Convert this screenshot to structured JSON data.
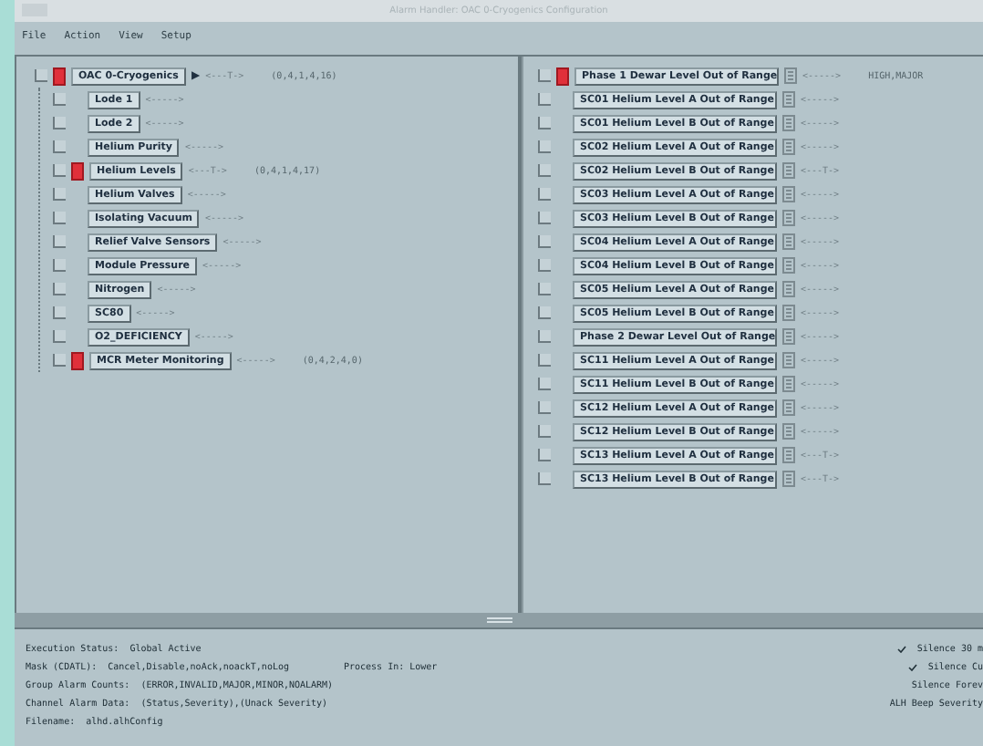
{
  "window": {
    "title": "Alarm Handler: OAC 0-Cryogenics Configuration"
  },
  "menu": [
    "File",
    "Action",
    "View",
    "Setup"
  ],
  "tree": [
    {
      "label": "OAC 0-Cryogenics",
      "alarm": true,
      "arrow": "▶",
      "mask": "<---T->",
      "counts": "(0,4,1,4,16)",
      "children": [
        {
          "label": "Lode 1",
          "alarm": false,
          "mask": "<----->"
        },
        {
          "label": "Lode 2",
          "alarm": false,
          "mask": "<----->"
        },
        {
          "label": "Helium Purity",
          "alarm": false,
          "mask": "<----->"
        },
        {
          "label": "Helium Levels",
          "alarm": true,
          "mask": "<---T->",
          "counts": "(0,4,1,4,17)"
        },
        {
          "label": "Helium Valves",
          "alarm": false,
          "mask": "<----->"
        },
        {
          "label": "Isolating Vacuum",
          "alarm": false,
          "mask": "<----->"
        },
        {
          "label": "Relief Valve Sensors",
          "alarm": false,
          "mask": "<----->"
        },
        {
          "label": "Module Pressure",
          "alarm": false,
          "mask": "<----->"
        },
        {
          "label": "Nitrogen",
          "alarm": false,
          "mask": "<----->"
        },
        {
          "label": "SC80",
          "alarm": false,
          "mask": "<----->"
        },
        {
          "label": "O2_DEFICIENCY",
          "alarm": false,
          "mask": "<----->"
        },
        {
          "label": "MCR Meter Monitoring",
          "alarm": true,
          "mask": "<----->",
          "counts": "(0,4,2,4,0)"
        }
      ]
    }
  ],
  "alarms": [
    {
      "label": "Phase 1 Dewar Level Out of Range",
      "alarm": true,
      "mask": "<----->",
      "status": "HIGH,MAJOR"
    },
    {
      "label": "SC01 Helium Level A Out of Range",
      "alarm": false,
      "mask": "<----->"
    },
    {
      "label": "SC01 Helium Level B Out of Range",
      "alarm": false,
      "mask": "<----->"
    },
    {
      "label": "SC02 Helium Level A Out of Range",
      "alarm": false,
      "mask": "<----->"
    },
    {
      "label": "SC02 Helium Level B Out of Range",
      "alarm": false,
      "mask": "<---T->"
    },
    {
      "label": "SC03 Helium Level A Out of Range",
      "alarm": false,
      "mask": "<----->"
    },
    {
      "label": "SC03 Helium Level B Out of Range",
      "alarm": false,
      "mask": "<----->"
    },
    {
      "label": "SC04 Helium Level A Out of Range",
      "alarm": false,
      "mask": "<----->"
    },
    {
      "label": "SC04 Helium Level B Out of Range",
      "alarm": false,
      "mask": "<----->"
    },
    {
      "label": "SC05 Helium Level A Out of Range",
      "alarm": false,
      "mask": "<----->"
    },
    {
      "label": "SC05 Helium Level B Out of Range",
      "alarm": false,
      "mask": "<----->"
    },
    {
      "label": "Phase 2 Dewar Level Out of Range",
      "alarm": false,
      "mask": "<----->"
    },
    {
      "label": "SC11 Helium Level A Out of Range",
      "alarm": false,
      "mask": "<----->"
    },
    {
      "label": "SC11 Helium Level B Out of Range",
      "alarm": false,
      "mask": "<----->"
    },
    {
      "label": "SC12 Helium Level A Out of Range",
      "alarm": false,
      "mask": "<----->"
    },
    {
      "label": "SC12 Helium Level B Out of Range",
      "alarm": false,
      "mask": "<----->"
    },
    {
      "label": "SC13 Helium Level A Out of Range",
      "alarm": false,
      "mask": "<---T->"
    },
    {
      "label": "SC13 Helium Level B Out of Range",
      "alarm": false,
      "mask": "<---T->"
    }
  ],
  "status": [
    {
      "label": "Execution Status:",
      "value": "Global Active"
    },
    {
      "label": "Mask (CDATL):",
      "value": "Cancel,Disable,noAck,noackT,noLog",
      "note": "Process In: Lower"
    },
    {
      "label": "Group Alarm Counts:",
      "value": "(ERROR,INVALID,MAJOR,MINOR,NOALARM)"
    },
    {
      "label": "Channel Alarm Data:",
      "value": "(Status,Severity),(Unack Severity)"
    },
    {
      "label": "Filename:",
      "value": "alhd.alhConfig"
    }
  ],
  "options": [
    {
      "label": "Silence 30 m",
      "checked": true
    },
    {
      "label": "Silence Cu",
      "checked": true
    },
    {
      "label": "Silence Forev",
      "checked": false
    },
    {
      "label": "ALH Beep Severity",
      "checked": false
    }
  ]
}
